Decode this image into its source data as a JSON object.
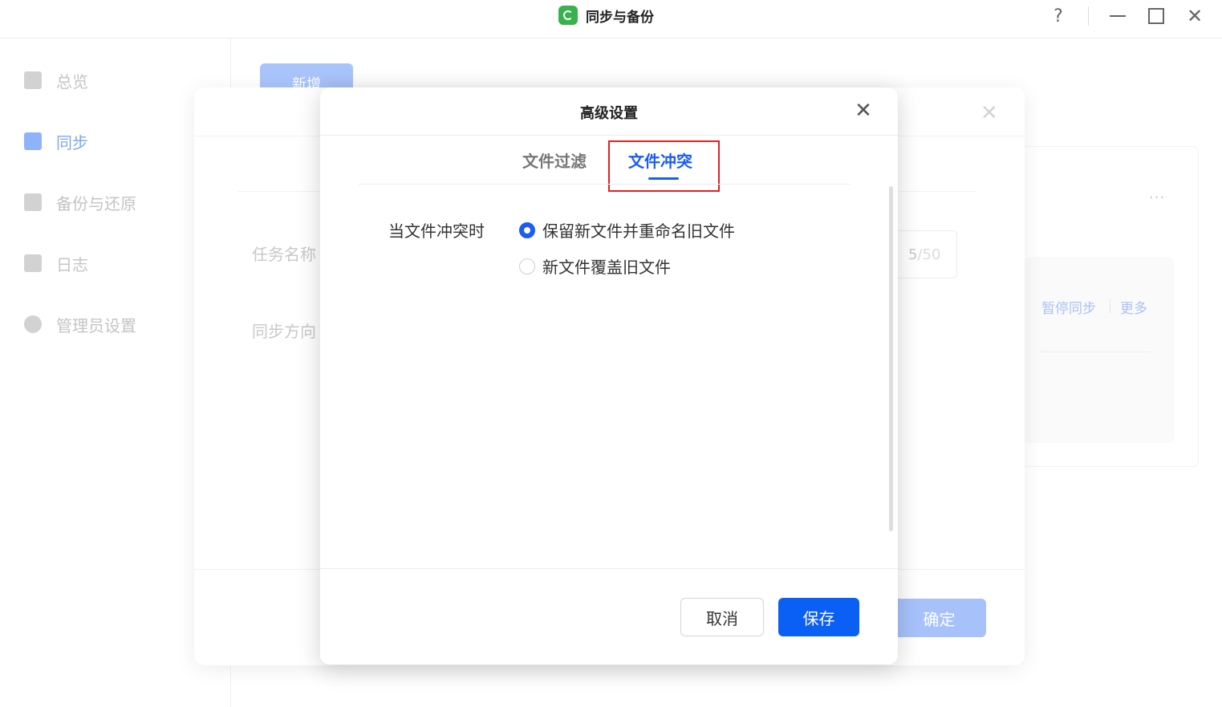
{
  "window": {
    "title": "同步与备份",
    "help_label": "?",
    "close_label": "✕"
  },
  "sidebar": {
    "items": [
      {
        "label": "总览",
        "icon": "chart-icon",
        "active": false
      },
      {
        "label": "同步",
        "icon": "sync-arrows-icon",
        "active": true
      },
      {
        "label": "备份与还原",
        "icon": "backup-icon",
        "active": false
      },
      {
        "label": "日志",
        "icon": "log-book-icon",
        "active": false
      },
      {
        "label": "管理员设置",
        "icon": "gear-icon",
        "active": false
      }
    ]
  },
  "background": {
    "add_button": "新增",
    "more_dots": "···",
    "pause_sync": "暂停同步",
    "more": "更多"
  },
  "back_dialog": {
    "close_label": "✕",
    "task_name_label": "任务名称",
    "sync_direction_label": "同步方向",
    "counter_value": "5",
    "counter_max": "/50",
    "ok_button": "确定"
  },
  "dialog": {
    "title": "高级设置",
    "close_label": "✕",
    "tabs": [
      {
        "label": "文件过滤",
        "active": false
      },
      {
        "label": "文件冲突",
        "active": true
      }
    ],
    "conflict_label": "当文件冲突时",
    "options": [
      {
        "label": "保留新文件并重命名旧文件",
        "checked": true
      },
      {
        "label": "新文件覆盖旧文件",
        "checked": false
      }
    ],
    "cancel_button": "取消",
    "save_button": "保存"
  },
  "colors": {
    "accent": "#1a5cf5",
    "highlight_box": "#e02020"
  }
}
